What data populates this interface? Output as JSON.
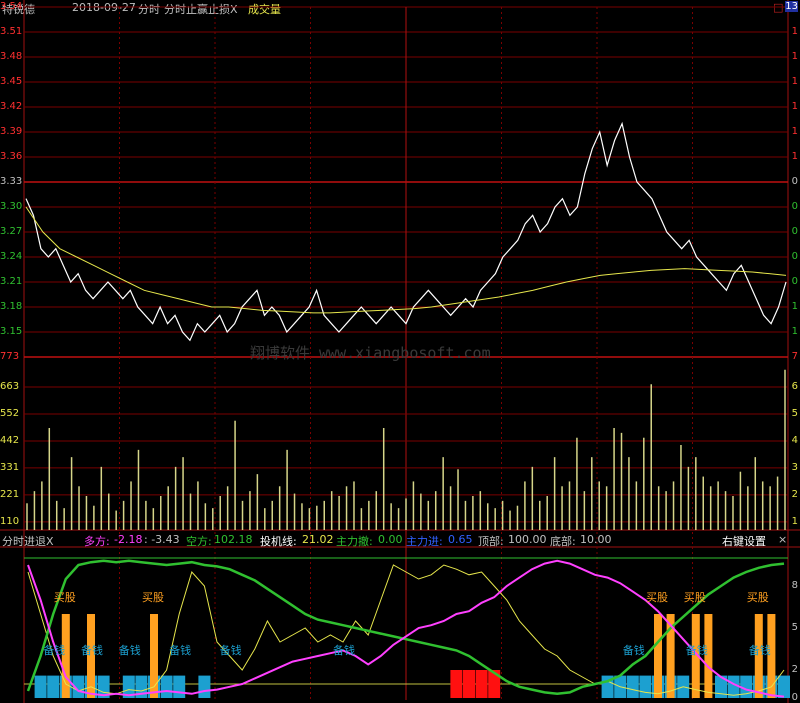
{
  "header": {
    "stock_name": "特锐德",
    "date": "2018-09-27",
    "period": "分时",
    "indicator": "分时止赢止损X",
    "volume_label": "成交量",
    "corner_box": "□"
  },
  "price_axis": {
    "labels": [
      "3.54",
      "3.51",
      "3.48",
      "3.45",
      "3.42",
      "3.39",
      "3.36",
      "3.33",
      "3.30",
      "3.27",
      "3.24",
      "3.21",
      "3.18",
      "3.15",
      "773"
    ],
    "colors": [
      "#ff3030",
      "#ff3030",
      "#ff3030",
      "#ff3030",
      "#ff3030",
      "#ff3030",
      "#ff3030",
      "#c0c0c0",
      "#30c030",
      "#30c030",
      "#30c030",
      "#30c030",
      "#30c030",
      "#30c030",
      "#ff3030"
    ],
    "right_labels": [
      "13",
      "1",
      "1",
      "1",
      "1",
      "1",
      "1",
      "0",
      "0",
      "0",
      "0",
      "0",
      "1",
      "1",
      "7"
    ],
    "right_colors": [
      "#ffffff",
      "#ff3030",
      "#ff3030",
      "#ff3030",
      "#ff3030",
      "#ff3030",
      "#ff3030",
      "#c0c0c0",
      "#30c030",
      "#30c030",
      "#30c030",
      "#30c030",
      "#30c030",
      "#30c030",
      "#ff3030"
    ]
  },
  "volume_axis": {
    "labels": [
      "663",
      "552",
      "442",
      "331",
      "221",
      "110"
    ],
    "right_labels": [
      "6",
      "5",
      "4",
      "3",
      "2",
      "1"
    ]
  },
  "indicator_bar": {
    "name": "分时进退X",
    "duo_label": "多方:",
    "duo_value": "-2.18",
    "sep_value": ": -3.43",
    "kong_label": "空方:",
    "kong_value": "102.18",
    "tou_label": "投机线:",
    "tou_value": "21.02",
    "zhuche_label": "主力撤:",
    "zhuche_value": "0.00",
    "zhujin_label": "主力进:",
    "zhujin_value": "0.65",
    "ding_label": "顶部:",
    "ding_value": "100.00",
    "di_label": "底部:",
    "di_value": "10.00",
    "settings": "右键设置",
    "close": "×"
  },
  "indicator_axis": {
    "right_labels": [
      "8",
      "5",
      "2",
      "0"
    ]
  },
  "signals": {
    "buy": "买股",
    "cash": "备钱"
  },
  "watermark": "翔博软件 www.xiangbosoft.com",
  "colors": {
    "background": "#000000",
    "grid_red": "#8b0000",
    "price_line": "#ffffff",
    "avg_line": "#e6e64c",
    "volume_bar": "#d6d68a",
    "duo_line": "#ff40ff",
    "kong_line": "#30c030",
    "tou_line": "#e6e64c",
    "buy_bar": "#ffa020",
    "cash_bar": "#1ca0d0",
    "top_bar": "#ff1010"
  },
  "chart_data": {
    "type": "line",
    "price": {
      "ylim": [
        3.12,
        3.54
      ],
      "values": [
        3.31,
        3.29,
        3.25,
        3.24,
        3.25,
        3.23,
        3.21,
        3.22,
        3.2,
        3.19,
        3.2,
        3.21,
        3.2,
        3.19,
        3.2,
        3.18,
        3.17,
        3.16,
        3.18,
        3.16,
        3.17,
        3.15,
        3.14,
        3.16,
        3.15,
        3.16,
        3.17,
        3.15,
        3.16,
        3.18,
        3.19,
        3.2,
        3.17,
        3.18,
        3.17,
        3.15,
        3.16,
        3.17,
        3.18,
        3.2,
        3.17,
        3.16,
        3.15,
        3.16,
        3.17,
        3.18,
        3.17,
        3.16,
        3.17,
        3.18,
        3.17,
        3.16,
        3.18,
        3.19,
        3.2,
        3.19,
        3.18,
        3.17,
        3.18,
        3.19,
        3.18,
        3.2,
        3.21,
        3.22,
        3.24,
        3.25,
        3.26,
        3.28,
        3.29,
        3.27,
        3.28,
        3.3,
        3.31,
        3.29,
        3.3,
        3.34,
        3.37,
        3.39,
        3.35,
        3.38,
        3.4,
        3.36,
        3.33,
        3.32,
        3.31,
        3.29,
        3.27,
        3.26,
        3.25,
        3.26,
        3.24,
        3.23,
        3.22,
        3.21,
        3.2,
        3.22,
        3.23,
        3.21,
        3.19,
        3.17,
        3.16,
        3.18,
        3.21
      ],
      "avg": [
        3.3,
        3.27,
        3.25,
        3.24,
        3.23,
        3.22,
        3.21,
        3.2,
        3.195,
        3.19,
        3.185,
        3.18,
        3.18,
        3.178,
        3.176,
        3.175,
        3.174,
        3.173,
        3.173,
        3.174,
        3.175,
        3.176,
        3.177,
        3.178,
        3.18,
        3.183,
        3.186,
        3.189,
        3.192,
        3.196,
        3.2,
        3.205,
        3.21,
        3.214,
        3.218,
        3.22,
        3.222,
        3.224,
        3.225,
        3.226,
        3.225,
        3.224,
        3.223,
        3.222,
        3.22,
        3.218
      ]
    },
    "volume": {
      "ylim": [
        0,
        700
      ],
      "values": [
        110,
        160,
        200,
        420,
        120,
        90,
        300,
        180,
        140,
        100,
        260,
        150,
        80,
        120,
        200,
        330,
        120,
        90,
        140,
        180,
        260,
        300,
        150,
        200,
        110,
        90,
        140,
        180,
        450,
        120,
        160,
        230,
        90,
        120,
        180,
        330,
        150,
        110,
        90,
        100,
        120,
        160,
        140,
        180,
        200,
        90,
        120,
        160,
        420,
        110,
        90,
        130,
        200,
        150,
        120,
        160,
        300,
        180,
        250,
        120,
        140,
        160,
        110,
        90,
        120,
        80,
        100,
        200,
        260,
        120,
        140,
        300,
        180,
        200,
        380,
        160,
        300,
        200,
        180,
        420,
        400,
        300,
        200,
        380,
        600,
        180,
        160,
        200,
        350,
        260,
        300,
        220,
        180,
        200,
        160,
        140,
        240,
        180,
        300,
        200,
        180,
        220,
        660
      ]
    },
    "indicator": {
      "ylim": [
        0,
        100
      ],
      "duo": [
        95,
        70,
        40,
        15,
        5,
        3,
        2,
        3,
        2,
        3,
        4,
        5,
        4,
        3,
        5,
        6,
        8,
        10,
        14,
        18,
        22,
        26,
        28,
        30,
        32,
        34,
        30,
        24,
        30,
        38,
        44,
        50,
        52,
        55,
        60,
        62,
        68,
        72,
        80,
        86,
        92,
        96,
        98,
        96,
        92,
        88,
        86,
        82,
        76,
        70,
        62,
        52,
        42,
        32,
        22,
        15,
        10,
        6,
        4,
        2,
        1
      ],
      "kong": [
        5,
        30,
        60,
        85,
        95,
        97,
        98,
        97,
        98,
        97,
        96,
        95,
        96,
        97,
        95,
        94,
        92,
        88,
        84,
        78,
        72,
        66,
        60,
        56,
        54,
        52,
        50,
        48,
        46,
        44,
        42,
        40,
        38,
        36,
        34,
        30,
        24,
        18,
        12,
        8,
        6,
        4,
        3,
        4,
        8,
        10,
        12,
        16,
        24,
        30,
        40,
        50,
        58,
        66,
        74,
        80,
        86,
        90,
        93,
        95,
        96
      ],
      "tou": [
        90,
        60,
        30,
        10,
        5,
        8,
        4,
        3,
        6,
        5,
        8,
        20,
        60,
        90,
        80,
        40,
        30,
        20,
        35,
        55,
        40,
        45,
        50,
        40,
        45,
        40,
        55,
        45,
        70,
        95,
        90,
        85,
        88,
        95,
        92,
        88,
        90,
        80,
        70,
        55,
        45,
        35,
        30,
        20,
        15,
        10,
        12,
        8,
        6,
        4,
        3,
        5,
        8,
        6,
        4,
        3,
        2,
        3,
        5,
        8,
        20
      ],
      "signals": [
        {
          "kind": "buy",
          "at": 3
        },
        {
          "kind": "buy",
          "at": 5
        },
        {
          "kind": "buy",
          "at": 10
        },
        {
          "kind": "buy",
          "at": 50
        },
        {
          "kind": "buy",
          "at": 51
        },
        {
          "kind": "buy",
          "at": 53
        },
        {
          "kind": "buy",
          "at": 54
        },
        {
          "kind": "buy",
          "at": 58
        },
        {
          "kind": "buy",
          "at": 59
        }
      ]
    }
  }
}
